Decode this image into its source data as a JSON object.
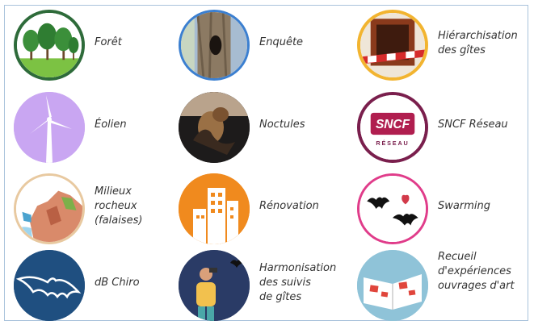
{
  "tiles": [
    {
      "label": "Forêt",
      "icon": "forest-icon"
    },
    {
      "label": "Enquête",
      "icon": "tree-trunk-hollow-icon"
    },
    {
      "label": "Hiérarchisation\ndes gîtes",
      "icon": "roost-box-tape-icon"
    },
    {
      "label": "Éolien",
      "icon": "wind-turbine-icon"
    },
    {
      "label": "Noctules",
      "icon": "bat-photo-icon"
    },
    {
      "label": "SNCF Réseau",
      "icon": "sncf-logo-icon"
    },
    {
      "label": "Milieux\nrocheux\n(falaises)",
      "icon": "cliff-icon"
    },
    {
      "label": "Rénovation",
      "icon": "building-icon"
    },
    {
      "label": "Swarming",
      "icon": "bats-heart-icon"
    },
    {
      "label": "dB Chiro",
      "icon": "bat-outline-icon"
    },
    {
      "label": "Harmonisation\ndes  suivis\nde gîtes",
      "icon": "observer-binoculars-icon"
    },
    {
      "label": "Recueil\nd'expériences\nouvrages d'art",
      "icon": "open-book-icon"
    }
  ],
  "logo_text": {
    "sncf": "SNCF",
    "reseau": "RÉSEAU"
  },
  "colors": {
    "foret_border": "#2e6b3a",
    "enquete_border": "#3b7fd0",
    "hierarchie_border": "#f2b430",
    "eolien_bg": "#c9a6f2",
    "noctules_bg": "#1d1b1b",
    "sncf_border": "#7a1f4d",
    "falaise_border": "#e8c9a0",
    "renovation_bg": "#f08a1e",
    "swarming_border": "#e03c8a",
    "dbchiro_bg": "#1f4f80",
    "harmonisation_bg": "#2a3b66",
    "recueil_bg": "#8fc3d8"
  }
}
